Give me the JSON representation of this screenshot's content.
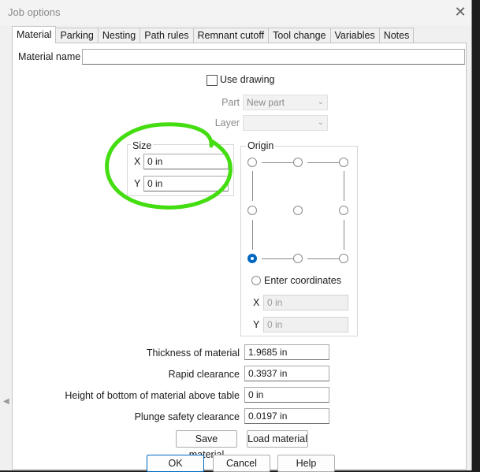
{
  "window": {
    "title": "Job options",
    "close": "✕"
  },
  "tabs": [
    "Material",
    "Parking",
    "Nesting",
    "Path rules",
    "Remnant cutoff",
    "Tool change",
    "Variables",
    "Notes"
  ],
  "material_name": {
    "label": "Material name",
    "value": ""
  },
  "use_drawing": {
    "label": "Use drawing",
    "checked": false
  },
  "part": {
    "label": "Part",
    "value": "New part"
  },
  "layer": {
    "label": "Layer",
    "value": ""
  },
  "size": {
    "label": "Size",
    "x_label": "X",
    "x_value": "0 in",
    "y_label": "Y",
    "y_value": "0 in"
  },
  "origin": {
    "label": "Origin",
    "selected": "bottom-left",
    "enter_coordinates_label": "Enter coordinates",
    "x_label": "X",
    "x_value": "0 in",
    "y_label": "Y",
    "y_value": "0 in"
  },
  "fields": [
    {
      "label": "Thickness of material",
      "value": "1.9685 in"
    },
    {
      "label": "Rapid clearance",
      "value": "0.3937 in"
    },
    {
      "label": "Height of bottom of material above table",
      "value": "0 in"
    },
    {
      "label": "Plunge safety clearance",
      "value": "0.0197 in"
    }
  ],
  "buttons": {
    "save_material": "Save material",
    "load_material": "Load material",
    "ok": "OK",
    "cancel": "Cancel",
    "help": "Help"
  },
  "colors": {
    "accent": "#0067c0",
    "annotation": "#44dd11"
  }
}
